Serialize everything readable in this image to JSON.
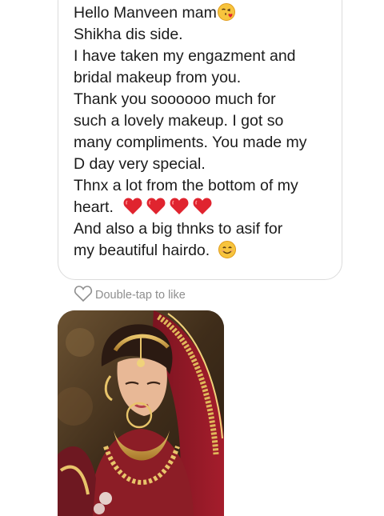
{
  "message": {
    "lines": [
      "Hello Manveen mam",
      "Shikha dis side.",
      "I have taken my engazment and",
      "bridal makeup from you.",
      "Thank you soooooo much for",
      "such a lovely makeup.  I got so",
      "many compliments. You made my",
      "D day very special.",
      "Thnx a lot from the bottom of my",
      "heart.",
      "And also a big thnks to asif for",
      "my beautiful hairdo."
    ],
    "emojis": {
      "line1": "face-blowing-kiss-icon",
      "line10": "red-heart-icon x4",
      "line12": "smiling-face-icon"
    }
  },
  "like_hint": {
    "label": "Double-tap to like",
    "icon": "heart-outline-icon"
  },
  "photo": {
    "subject": "bride-photo"
  },
  "colors": {
    "text": "#1b1b1b",
    "bubble_border": "#dcdcdc",
    "hint_text": "#8e8e8e",
    "heart_red": "#e0242f",
    "emoji_yellow": "#f7c43d"
  }
}
